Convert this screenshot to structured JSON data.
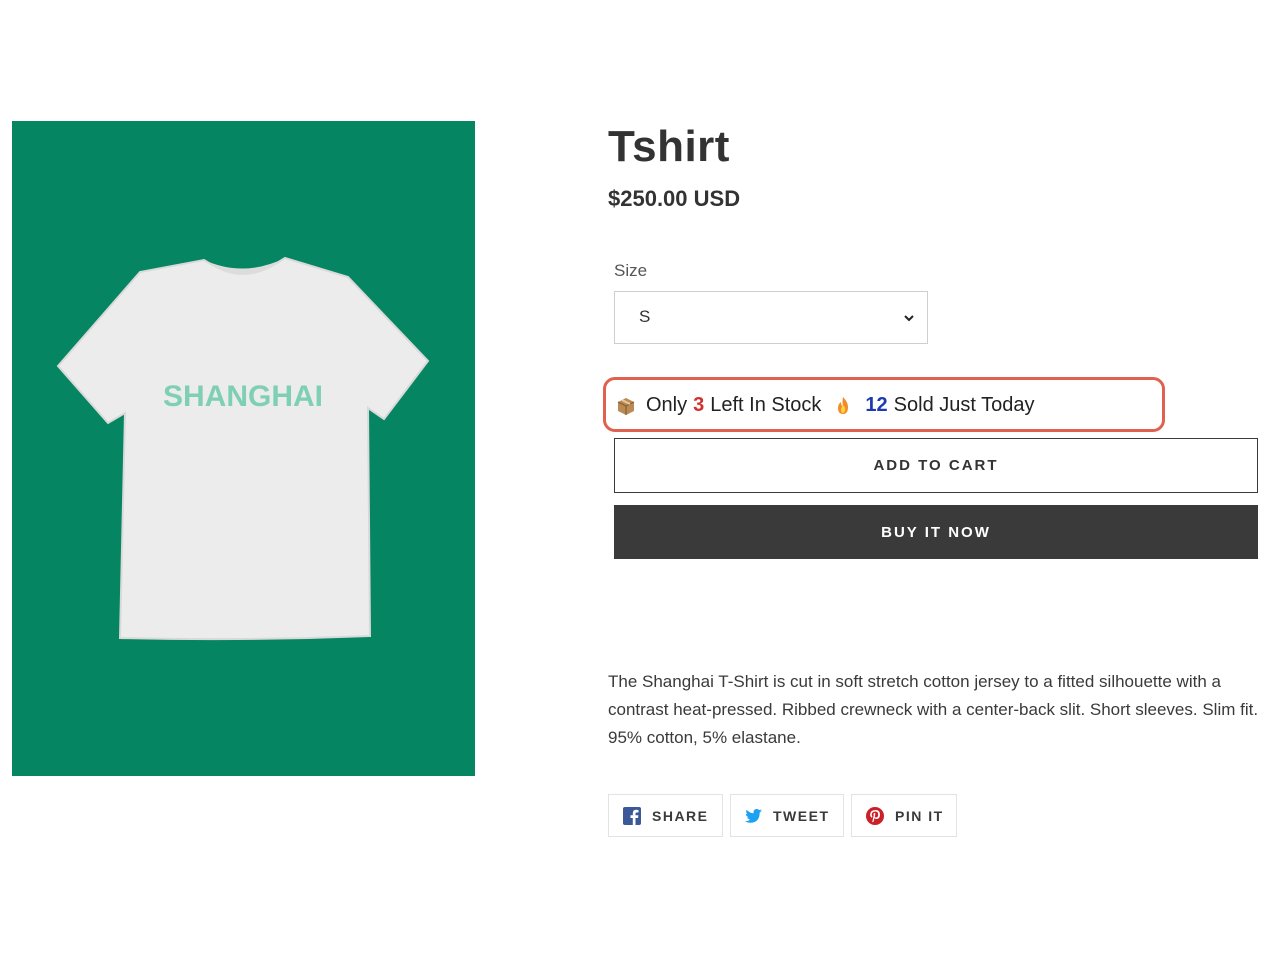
{
  "product": {
    "title": "Tshirt",
    "price": "$250.00 USD",
    "image_text": "SHANGHAI",
    "image_bg_color": "#068562",
    "shirt_text_color": "#7fcfb5"
  },
  "size": {
    "label": "Size",
    "selected": "S"
  },
  "urgency": {
    "prefix": "Only",
    "stock_count": "3",
    "stock_suffix": "Left In Stock",
    "sold_count": "12",
    "sold_suffix": "Sold Just Today",
    "border_color": "#e0614f"
  },
  "buttons": {
    "add_to_cart": "ADD TO CART",
    "buy_now": "BUY IT NOW"
  },
  "description": "The Shanghai T-Shirt is cut in soft stretch cotton jersey to a fitted silhouette with a contrast heat-pressed. Ribbed crewneck with a center-back slit. Short sleeves. Slim fit. 95% cotton, 5% elastane.",
  "social": {
    "share": "SHARE",
    "tweet": "TWEET",
    "pin": "PIN IT"
  }
}
